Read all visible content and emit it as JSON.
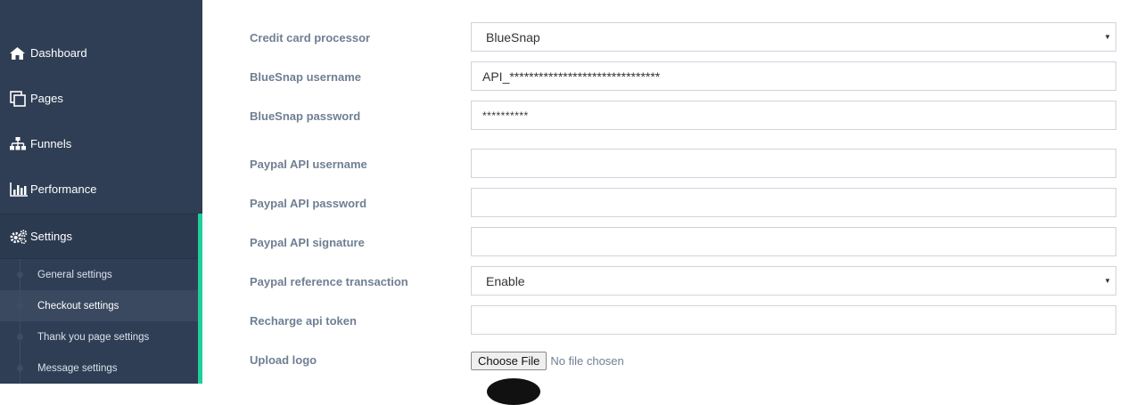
{
  "sidebar": {
    "nav": [
      {
        "label": "Dashboard",
        "icon": "home-icon"
      },
      {
        "label": "Pages",
        "icon": "pages-icon"
      },
      {
        "label": "Funnels",
        "icon": "sitemap-icon"
      },
      {
        "label": "Performance",
        "icon": "bar-chart-icon"
      },
      {
        "label": "Settings",
        "icon": "gears-icon"
      }
    ],
    "settings_sub": [
      {
        "label": "General settings"
      },
      {
        "label": "Checkout settings",
        "active": true
      },
      {
        "label": "Thank you page settings"
      },
      {
        "label": "Message settings"
      }
    ],
    "colors": {
      "background": "#2f3e55",
      "active_accent": "#1fcf9a"
    }
  },
  "form": {
    "credit_card_processor": {
      "label": "Credit card processor",
      "value": "BlueSnap"
    },
    "bluesnap_username": {
      "label": "BlueSnap username",
      "value": "API_*******************************"
    },
    "bluesnap_password": {
      "label": "BlueSnap password",
      "value": "**********"
    },
    "paypal_api_username": {
      "label": "Paypal API username",
      "value": ""
    },
    "paypal_api_password": {
      "label": "Paypal API password",
      "value": ""
    },
    "paypal_api_signature": {
      "label": "Paypal API signature",
      "value": ""
    },
    "paypal_reference_transaction": {
      "label": "Paypal reference transaction",
      "value": "Enable"
    },
    "recharge_api_token": {
      "label": "Recharge api token",
      "value": ""
    },
    "upload_logo": {
      "label": "Upload logo",
      "button": "Choose File",
      "status": "No file chosen"
    }
  }
}
